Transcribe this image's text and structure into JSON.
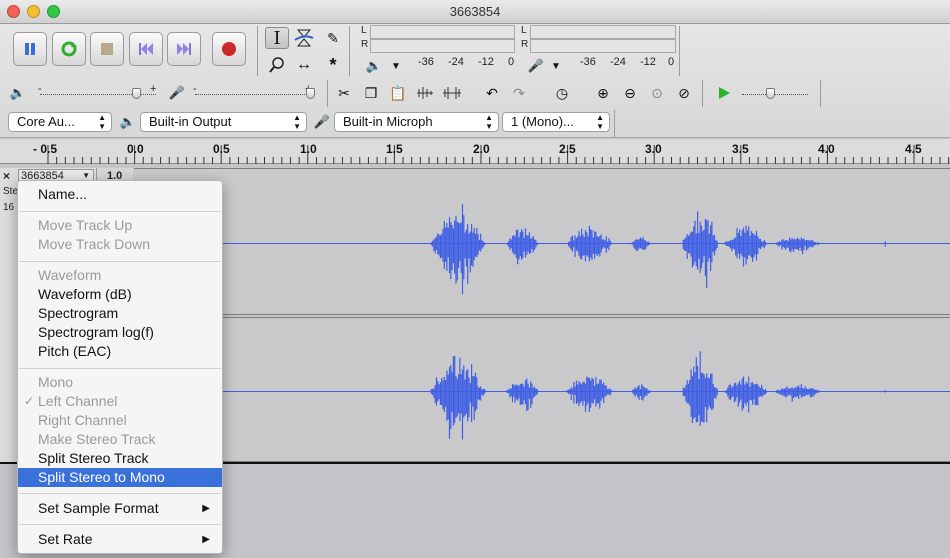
{
  "window": {
    "title": "3663854"
  },
  "colors": {
    "waveform": "#3e5ee5",
    "menu_highlight": "#3a70d9",
    "record": "#cc2a2a",
    "play": "#2bb52b"
  },
  "transport": {
    "buttons": [
      "pause-icon",
      "loop-icon",
      "stop-icon",
      "skip-start-icon",
      "skip-end-icon",
      "record-icon"
    ]
  },
  "tools": [
    "i-beam-icon",
    "envelope-icon",
    "pencil-icon",
    "zoom-icon",
    "time-shift-icon",
    "multi-tool-icon"
  ],
  "meters": {
    "l": "L",
    "r": "R",
    "play_scale": [
      "-36",
      "-24",
      "-12",
      "0"
    ],
    "rec_scale": [
      "-36",
      "-24",
      "-12",
      "0"
    ]
  },
  "mixer": {
    "minus": "-",
    "plus": "+"
  },
  "devices": {
    "host": "Core Au...",
    "output": "Built-in Output",
    "input": "Built-in Microph",
    "channels": "1 (Mono)..."
  },
  "ruler": {
    "labels": [
      "- 0.5",
      "0.0",
      "0.5",
      "1.0",
      "1.5",
      "2.0",
      "2.5",
      "3.0",
      "3.5",
      "4.0",
      "4.5"
    ]
  },
  "track": {
    "close": "×",
    "name": "3663854",
    "menu_arrow": "▼",
    "scale_top": "1.0",
    "info_lines": [
      "Ste",
      "16"
    ]
  },
  "menu": {
    "items": [
      {
        "label": "Name...",
        "enabled": true
      },
      {
        "label": "Move Track Up",
        "enabled": false
      },
      {
        "label": "Move Track Down",
        "enabled": false
      },
      {
        "label": "Waveform",
        "enabled": false
      },
      {
        "label": "Waveform (dB)",
        "enabled": true
      },
      {
        "label": "Spectrogram",
        "enabled": true
      },
      {
        "label": "Spectrogram log(f)",
        "enabled": true
      },
      {
        "label": "Pitch (EAC)",
        "enabled": true
      },
      {
        "label": "Mono",
        "enabled": false
      },
      {
        "label": "Left Channel",
        "enabled": false,
        "checked": true
      },
      {
        "label": "Right Channel",
        "enabled": false
      },
      {
        "label": "Make Stereo Track",
        "enabled": false
      },
      {
        "label": "Split Stereo Track",
        "enabled": true
      },
      {
        "label": "Split Stereo to Mono",
        "enabled": true,
        "highlighted": true
      },
      {
        "label": "Set Sample Format",
        "enabled": true,
        "submenu": true
      },
      {
        "label": "Set Rate",
        "enabled": true,
        "submenu": true
      }
    ],
    "checkmark": "✓",
    "chevron": "▶"
  }
}
